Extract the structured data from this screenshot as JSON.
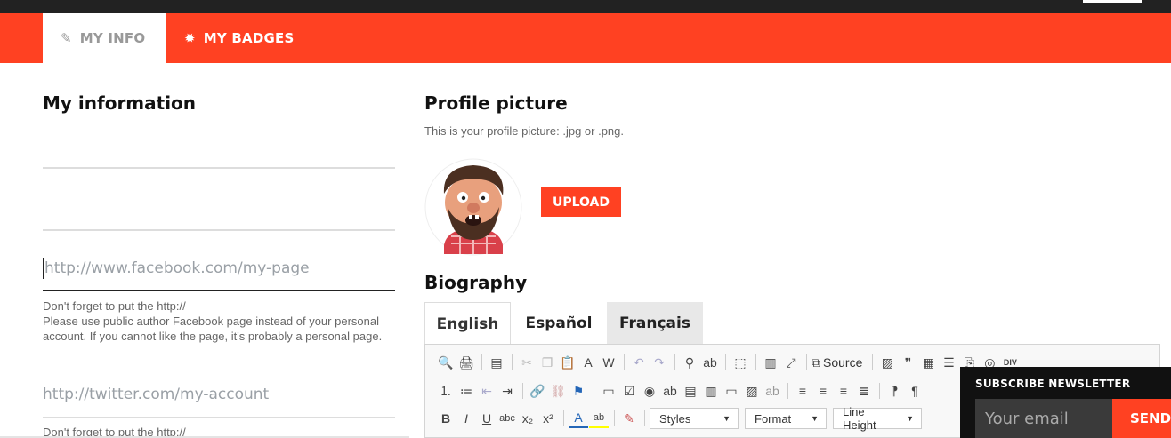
{
  "tabs": {
    "my_info": "MY INFO",
    "my_badges": "MY BADGES"
  },
  "left": {
    "title": "My information",
    "facebook_placeholder": "http://www.facebook.com/my-page",
    "facebook_help": [
      "Don't forget to put the http://",
      "Please use public author Facebook page instead of your personal account. If you cannot like the page, it's probably a personal page."
    ],
    "twitter_placeholder": "http://twitter.com/my-account",
    "twitter_help": "Don't forget to put the http://"
  },
  "profile": {
    "title": "Profile picture",
    "hint": "This is your profile picture: .jpg or .png.",
    "upload_label": "UPLOAD"
  },
  "biography": {
    "title": "Biography",
    "languages": [
      "English",
      "Español",
      "Français"
    ],
    "toolbar": {
      "source_label": "Source",
      "styles_label": "Styles",
      "format_label": "Format",
      "line_height_label": "Line Height"
    }
  },
  "newsletter": {
    "title": "SUBSCRIBE NEWSLETTER",
    "email_placeholder": "Your email",
    "send_label": "SEND"
  },
  "colors": {
    "accent": "#ff4122",
    "topbar": "#222222",
    "newsletter_bg": "#111111"
  }
}
